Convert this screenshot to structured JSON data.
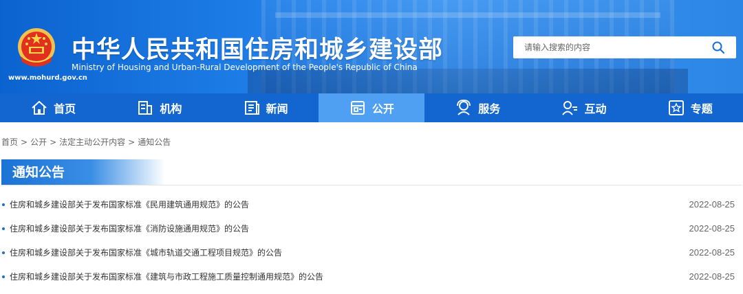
{
  "header": {
    "title_cn": "中华人民共和国住房和城乡建设部",
    "title_en": "Ministry of Housing and Urban-Rural Development of the People's Republic of China",
    "site_url": "www.mohurd.gov.cn",
    "emblem_icon": "national-emblem-icon"
  },
  "search": {
    "placeholder": "请输入搜索的内容",
    "icon": "search-icon"
  },
  "nav": {
    "items": [
      {
        "label": "首页",
        "icon": "home-icon"
      },
      {
        "label": "机构",
        "icon": "building-icon"
      },
      {
        "label": "新闻",
        "icon": "newspaper-icon"
      },
      {
        "label": "公开",
        "icon": "document-icon",
        "active": true
      },
      {
        "label": "服务",
        "icon": "service-icon"
      },
      {
        "label": "互动",
        "icon": "chat-user-icon"
      },
      {
        "label": "专题",
        "icon": "star-icon"
      }
    ]
  },
  "breadcrumb": {
    "items": [
      "首页",
      "公开",
      "法定主动公开内容",
      "通知公告"
    ],
    "separator": ">"
  },
  "section": {
    "title": "通知公告"
  },
  "list": {
    "items": [
      {
        "title": "住房和城乡建设部关于发布国家标准《民用建筑通用规范》的公告",
        "date": "2022-08-25"
      },
      {
        "title": "住房和城乡建设部关于发布国家标准《消防设施通用规范》的公告",
        "date": "2022-08-25"
      },
      {
        "title": "住房和城乡建设部关于发布国家标准《城市轨道交通工程项目规范》的公告",
        "date": "2022-08-25"
      },
      {
        "title": "住房和城乡建设部关于发布国家标准《建筑与市政工程施工质量控制通用规范》的公告",
        "date": "2022-08-25"
      }
    ]
  },
  "colors": {
    "header_blue": "#1f7ee8",
    "nav_blue": "#1366d0",
    "nav_active": "#4f9ff2",
    "section_blue": "#1a73d6"
  }
}
